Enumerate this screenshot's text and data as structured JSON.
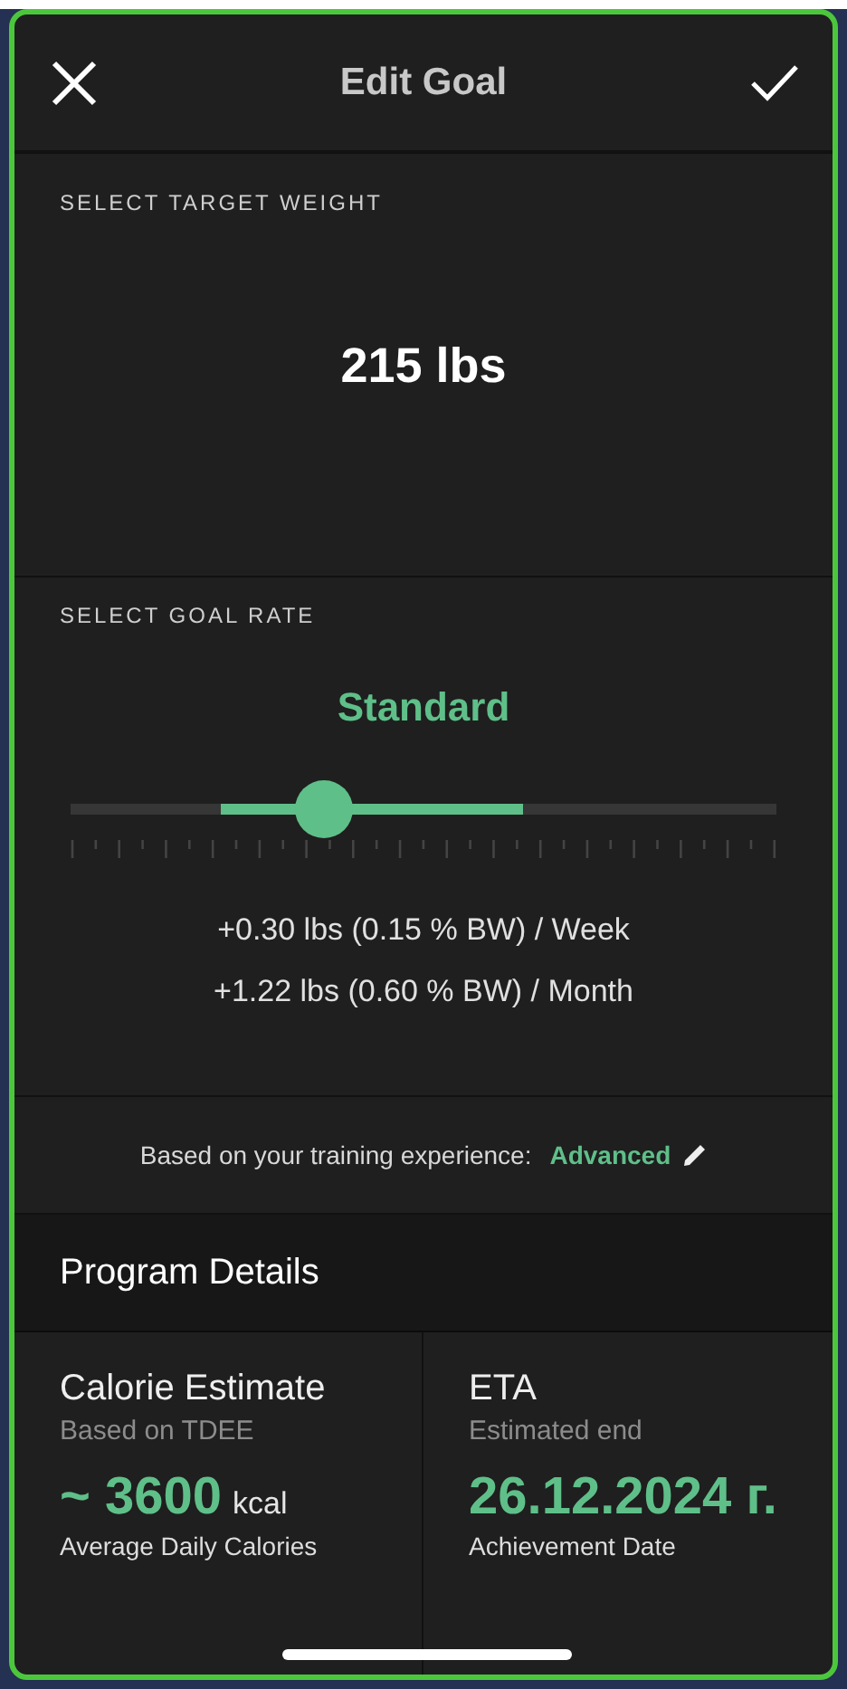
{
  "header": {
    "title": "Edit Goal"
  },
  "target_weight": {
    "label": "SELECT TARGET WEIGHT",
    "value": "215 lbs"
  },
  "goal_rate": {
    "label": "SELECT GOAL RATE",
    "rate_name": "Standard",
    "slider": {
      "level": 0.36
    },
    "lines": [
      "+0.30 lbs (0.15 % BW) / Week",
      "+1.22 lbs (0.60 % BW) / Month"
    ]
  },
  "experience": {
    "text": "Based on your training experience:",
    "value": "Advanced"
  },
  "program_details": {
    "title": "Program Details",
    "cards": [
      {
        "title": "Calorie Estimate",
        "subtitle": "Based on TDEE",
        "value": "~ 3600",
        "unit": "kcal",
        "caption": "Average Daily Calories"
      },
      {
        "title": "ETA",
        "subtitle": "Estimated end",
        "value": "26.12.2024 г.",
        "caption": "Achievement Date"
      }
    ]
  }
}
